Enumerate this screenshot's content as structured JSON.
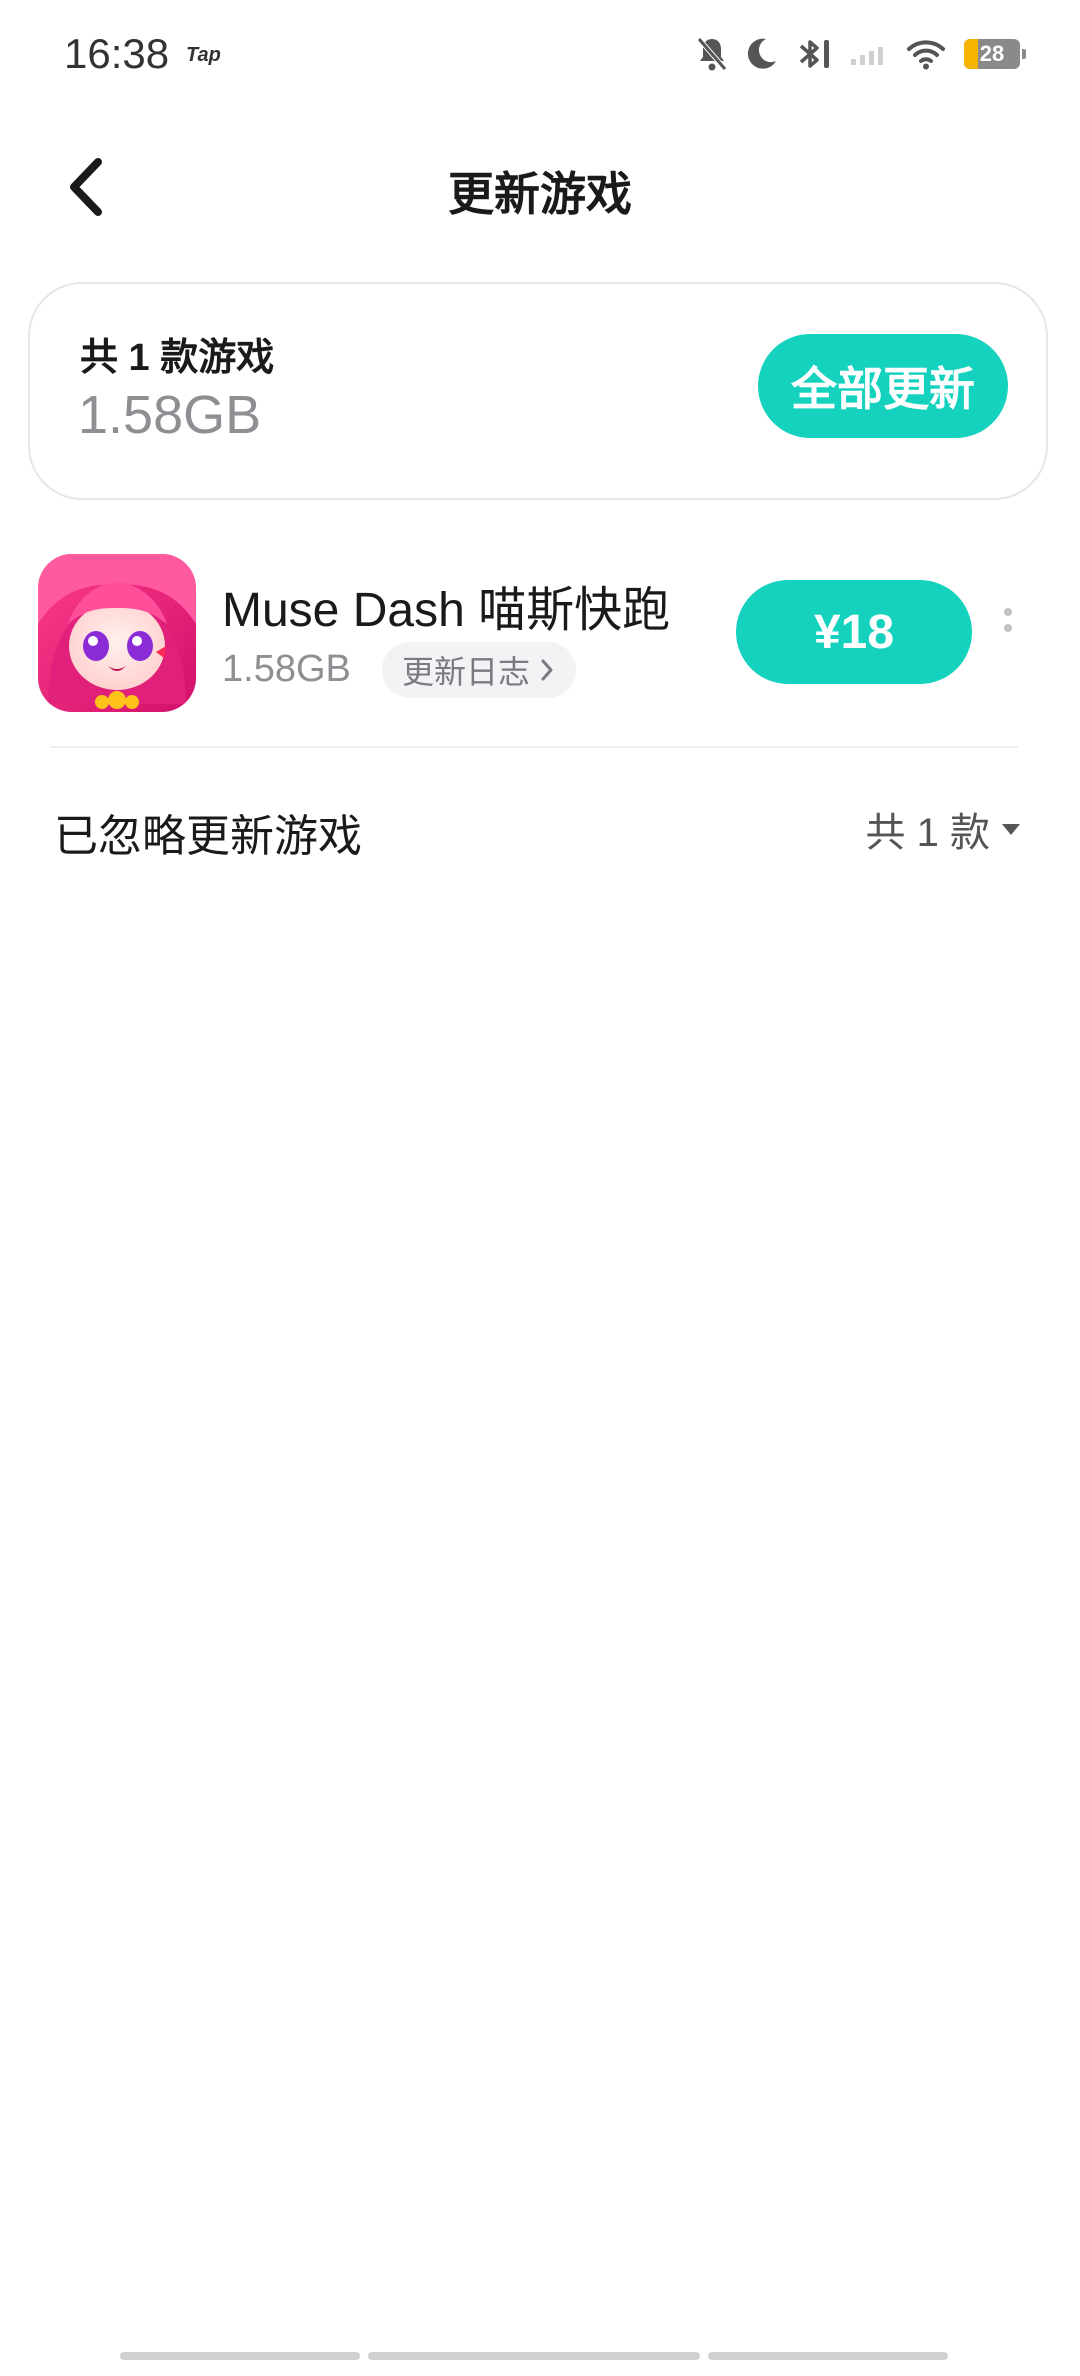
{
  "status_bar": {
    "time": "16:38",
    "app_badge": "Tap",
    "battery": "28",
    "icons": [
      "mute-bell-icon",
      "moon-icon",
      "bluetooth-icon",
      "signal-icon",
      "wifi-icon",
      "battery-icon"
    ]
  },
  "nav": {
    "title": "更新游戏",
    "back_icon": "back-arrow-icon"
  },
  "summary": {
    "count_label": "共 1 款游戏",
    "total_size": "1.58GB",
    "update_all_label": "全部更新"
  },
  "games": [
    {
      "name": "Muse Dash 喵斯快跑",
      "size": "1.58GB",
      "changelog_label": "更新日志",
      "price_label": "¥18"
    }
  ],
  "ignored": {
    "title": "已忽略更新游戏",
    "count_label": "共 1 款"
  },
  "colors": {
    "accent": "#15d2bf",
    "secondary_text": "#8e8e93"
  }
}
